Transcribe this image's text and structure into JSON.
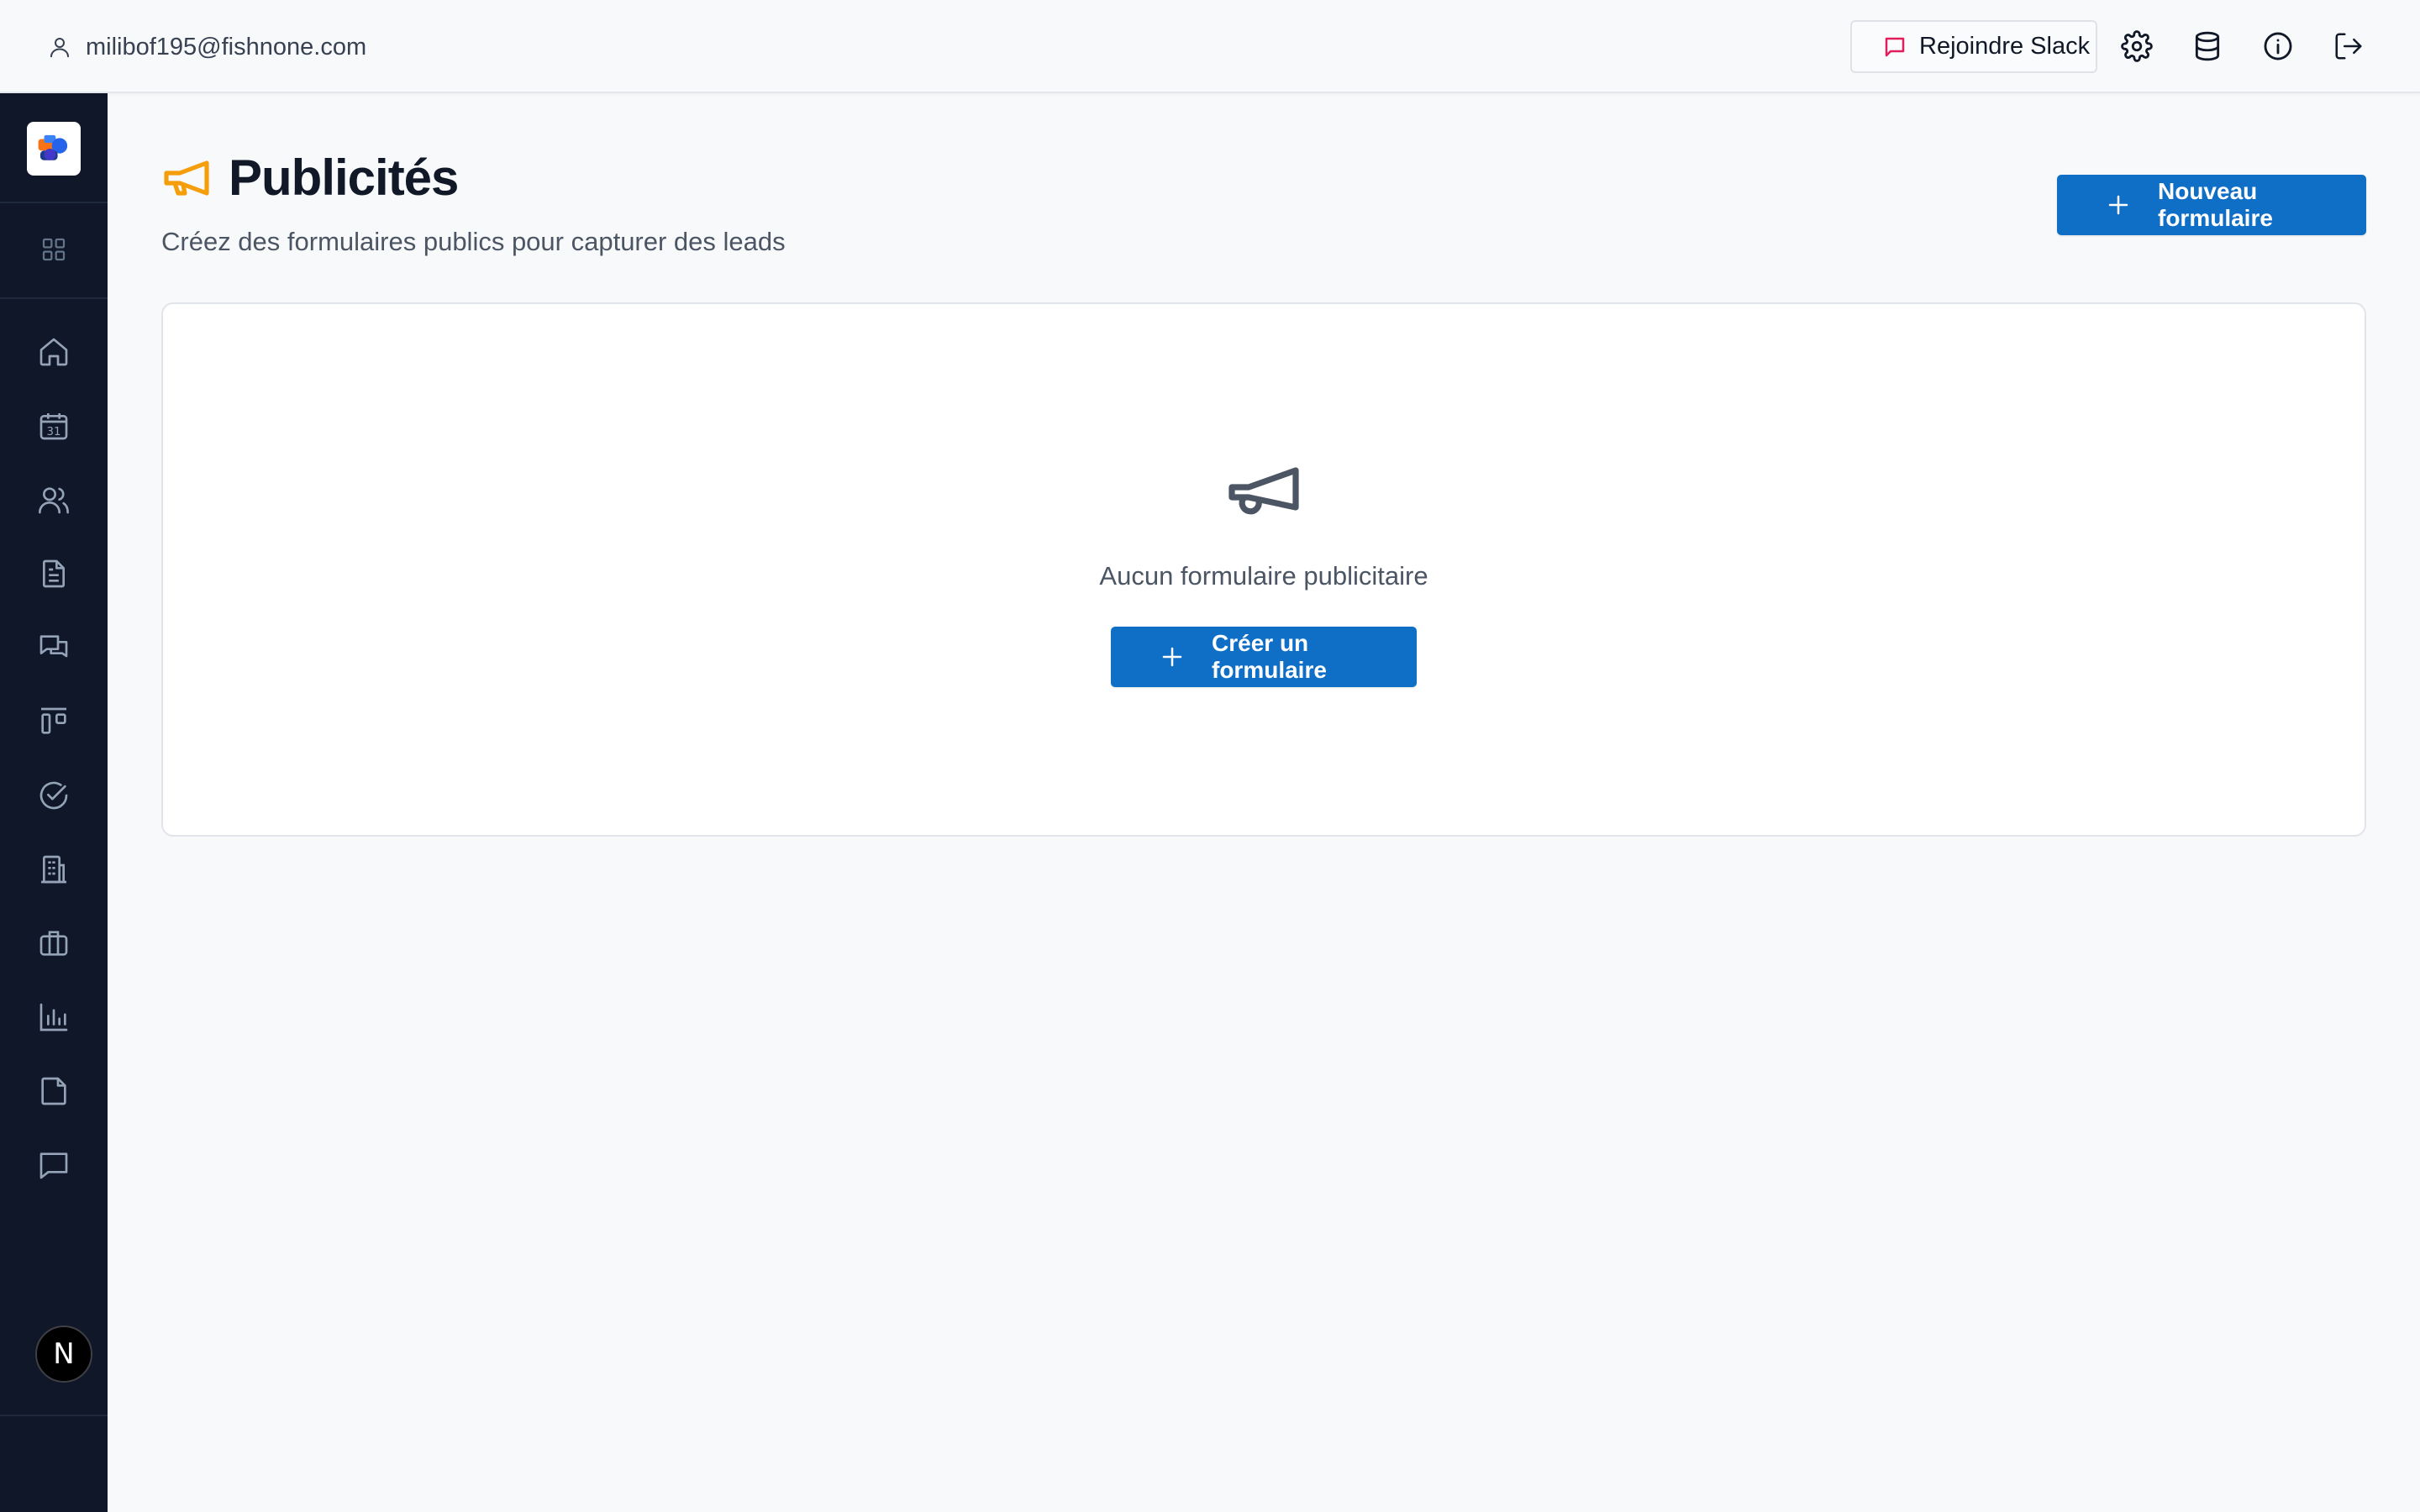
{
  "topbar": {
    "user_email": "milibof195@fishnone.com",
    "slack_label": "Rejoindre Slack",
    "icons": [
      "settings-icon",
      "database-icon",
      "info-icon",
      "logout-icon"
    ]
  },
  "sidebar": {
    "icons": [
      "home-icon",
      "calendar-icon",
      "users-icon",
      "document-icon",
      "chat-icon",
      "kanban-icon",
      "check-circle-icon",
      "building-icon",
      "briefcase-icon",
      "bar-chart-icon",
      "file-icon",
      "message-icon"
    ],
    "calendar_day": "31",
    "avatar_letter": "N"
  },
  "page": {
    "title": "Publicités",
    "subtitle": "Créez des formulaires publics pour capturer des leads",
    "new_button": "Nouveau formulaire",
    "accent": "#f59e0b"
  },
  "empty_state": {
    "message": "Aucun formulaire publicitaire",
    "create_button": "Créer un formulaire"
  },
  "colors": {
    "primary": "#0f6fc6",
    "sidebar": "#0f1729",
    "slack": "#e01e5a"
  }
}
